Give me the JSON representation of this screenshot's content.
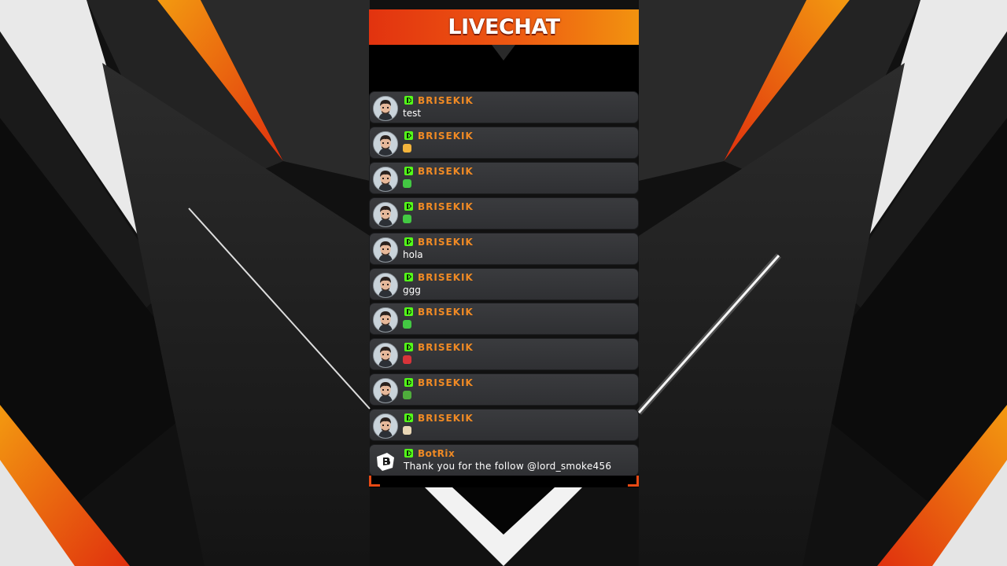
{
  "header": {
    "title": "LIVECHAT"
  },
  "messages": [
    {
      "username": "BRISEKIK",
      "text": "test",
      "emote": null
    },
    {
      "username": "BRISEKIK",
      "text": "",
      "emote": "#f3b43c"
    },
    {
      "username": "BRISEKIK",
      "text": "",
      "emote": "#43c943"
    },
    {
      "username": "BRISEKIK",
      "text": "",
      "emote": "#43c943"
    },
    {
      "username": "BRISEKIK",
      "text": "hola",
      "emote": null
    },
    {
      "username": "BRISEKIK",
      "text": "ggg",
      "emote": null
    },
    {
      "username": "BRISEKIK",
      "text": "",
      "emote": "#43c943"
    },
    {
      "username": "BRISEKIK",
      "text": "",
      "emote": "#d8343a"
    },
    {
      "username": "BRISEKIK",
      "text": "",
      "emote": "#4fae3c"
    },
    {
      "username": "BRISEKIK",
      "text": "",
      "emote": "#e9d7b6"
    }
  ],
  "bot_message": {
    "username": "BotRix",
    "text": "Thank you for the follow @lord_smoke456"
  },
  "colors": {
    "accent_orange": "#f08a24",
    "header_left": "#e2330f",
    "header_right": "#f2930f",
    "kick_green": "#53fc18",
    "botrix_name": "#f08a24"
  }
}
